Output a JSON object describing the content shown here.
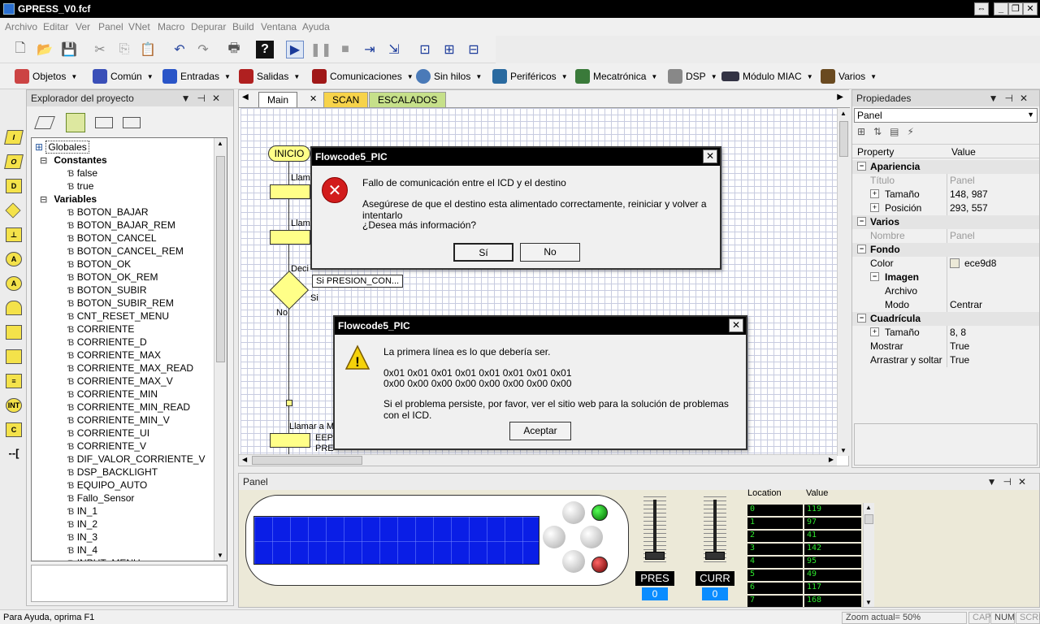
{
  "window": {
    "title": "GPRESS_V0.fcf"
  },
  "menu": [
    "Archivo",
    "Editar",
    "Ver",
    "Panel",
    "VNet",
    "Macro",
    "Depurar",
    "Build",
    "Ventana",
    "Ayuda"
  ],
  "component_bar": [
    {
      "label": "Objetos",
      "color": "#c44"
    },
    {
      "label": "Común",
      "color": "#3a4fb8"
    },
    {
      "label": "Entradas",
      "color": "#2a55c8"
    },
    {
      "label": "Salidas",
      "color": "#b02020"
    },
    {
      "label": "Comunicaciones",
      "color": "#a01818"
    },
    {
      "label": "Sin hilos",
      "color": "#4a7ab8"
    },
    {
      "label": "Periféricos",
      "color": "#2a6aa0"
    },
    {
      "label": "Mecatrónica",
      "color": "#3a7a3a"
    },
    {
      "label": "DSP",
      "color": "#888"
    },
    {
      "label": "Módulo MIAC",
      "color": "#334"
    },
    {
      "label": "Varios",
      "color": "#6a4a20"
    }
  ],
  "project_explorer": {
    "title": "Explorador del proyecto",
    "root": "Globales",
    "constants_label": "Constantes",
    "constants": [
      "false",
      "true"
    ],
    "variables_label": "Variables",
    "variables": [
      "BOTON_BAJAR",
      "BOTON_BAJAR_REM",
      "BOTON_CANCEL",
      "BOTON_CANCEL_REM",
      "BOTON_OK",
      "BOTON_OK_REM",
      "BOTON_SUBIR",
      "BOTON_SUBIR_REM",
      "CNT_RESET_MENU",
      "CORRIENTE",
      "CORRIENTE_D",
      "CORRIENTE_MAX",
      "CORRIENTE_MAX_READ",
      "CORRIENTE_MAX_V",
      "CORRIENTE_MIN",
      "CORRIENTE_MIN_READ",
      "CORRIENTE_MIN_V",
      "CORRIENTE_UI",
      "CORRIENTE_V",
      "DIF_VALOR_CORRIENTE_V",
      "DSP_BACKLIGHT",
      "EQUIPO_AUTO",
      "Fallo_Sensor",
      "IN_1",
      "IN_2",
      "IN_3",
      "IN_4",
      "INPUT_MENU"
    ]
  },
  "editor": {
    "tabs": [
      {
        "label": "Main",
        "color": "#ffffff"
      },
      {
        "label": "SCAN",
        "color": "#f7d34a"
      },
      {
        "label": "ESCALADOS",
        "color": "#c6e08a"
      }
    ],
    "flow": {
      "start": "INICIO",
      "call1": "Llama",
      "call2": "Llama",
      "decision": "Deci",
      "decision_label": "Si PRESION_CON...",
      "yes": "Si",
      "no": "No",
      "call3": "Llamar a M",
      "comment_a": "EEP",
      "comment_b": "PRE"
    }
  },
  "dialog_error": {
    "title": "Flowcode5_PIC",
    "line1": "Fallo de comunicación entre el ICD y el destino",
    "line2": "Asegúrese de que el destino esta alimentado correctamente, reiniciar y volver a intentarlo",
    "line3": "¿Desea más información?",
    "yes": "Sí",
    "no": "No"
  },
  "dialog_warning": {
    "title": "Flowcode5_PIC",
    "line1": "La primera línea es lo que debería ser.",
    "hex1": "0x01 0x01 0x01 0x01 0x01 0x01 0x01 0x01",
    "hex2": "0x00 0x00 0x00 0x00 0x00 0x00 0x00 0x00",
    "line3": "Si el problema persiste, por favor, ver el sitio web para la solución de problemas con el ICD.",
    "ok": "Aceptar"
  },
  "properties": {
    "title": "Propiedades",
    "selector": "Panel",
    "col_property": "Property",
    "col_value": "Value",
    "rows": [
      {
        "name": "Apariencia",
        "value": "",
        "kind": "group"
      },
      {
        "name": "Título",
        "value": "Panel",
        "kind": "gray"
      },
      {
        "name": "Tamaño",
        "value": "148, 987",
        "kind": "expand"
      },
      {
        "name": "Posición",
        "value": "293, 557",
        "kind": "expand"
      },
      {
        "name": "Varios",
        "value": "",
        "kind": "group"
      },
      {
        "name": "Nombre",
        "value": "Panel",
        "kind": "gray"
      },
      {
        "name": "Fondo",
        "value": "",
        "kind": "group"
      },
      {
        "name": "Color",
        "value": "ece9d8",
        "kind": "color"
      },
      {
        "name": "Imagen",
        "value": "",
        "kind": "subgroup"
      },
      {
        "name": "Archivo",
        "value": "",
        "kind": "sub"
      },
      {
        "name": "Modo",
        "value": "Centrar",
        "kind": "sub"
      },
      {
        "name": "Cuadrícula",
        "value": "",
        "kind": "group"
      },
      {
        "name": "Tamaño",
        "value": "8, 8",
        "kind": "expand"
      },
      {
        "name": "Mostrar",
        "value": "True",
        "kind": "plain"
      },
      {
        "name": "Arrastrar y soltar",
        "value": "True",
        "kind": "plain"
      }
    ]
  },
  "panel": {
    "title": "Panel",
    "pres_label": "PRES",
    "pres_value": "0",
    "curr_label": "CURR",
    "curr_value": "0",
    "mem_col1": "Location",
    "mem_col2": "Value",
    "mem": [
      [
        "0",
        "119"
      ],
      [
        "1",
        "97"
      ],
      [
        "2",
        "41"
      ],
      [
        "3",
        "142"
      ],
      [
        "4",
        "95"
      ],
      [
        "5",
        "49"
      ],
      [
        "6",
        "117"
      ],
      [
        "7",
        "168"
      ]
    ]
  },
  "status": {
    "help": "Para Ayuda, oprima F1",
    "zoom": "Zoom actual= 50%",
    "cap": "CAP",
    "num": "NUM",
    "scrl": "SCRL"
  }
}
